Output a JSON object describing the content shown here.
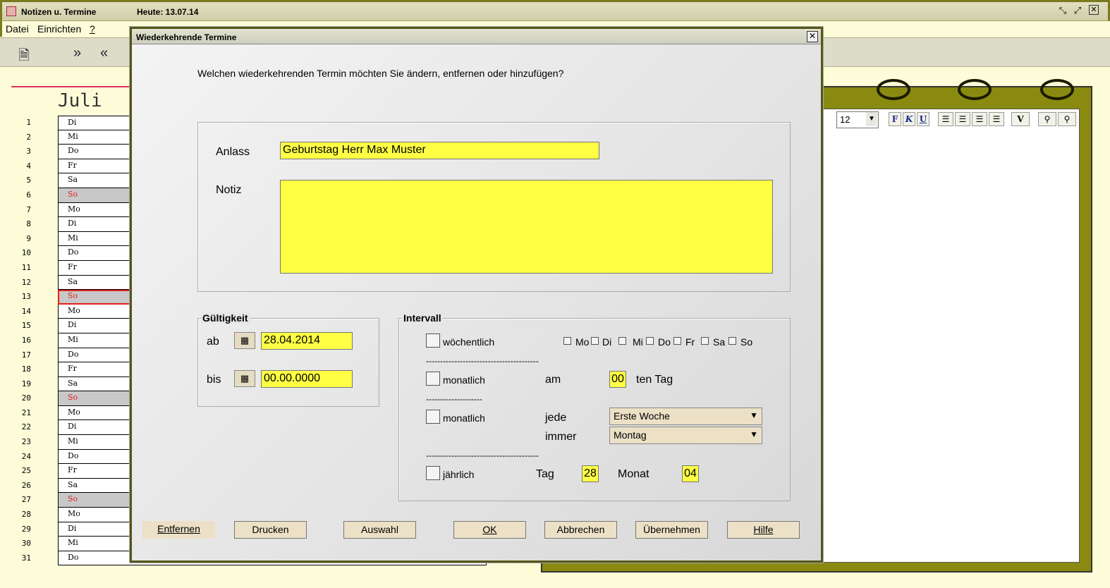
{
  "app": {
    "title": "Notizen u. Termine",
    "today": "Heute: 13.07.14"
  },
  "menu": [
    "Datei",
    "Einrichten",
    "?"
  ],
  "calendar": {
    "month": "Juli",
    "days": [
      {
        "n": "1",
        "d": "Di"
      },
      {
        "n": "2",
        "d": "Mi"
      },
      {
        "n": "3",
        "d": "Do"
      },
      {
        "n": "4",
        "d": "Fr"
      },
      {
        "n": "5",
        "d": "Sa"
      },
      {
        "n": "6",
        "d": "So"
      },
      {
        "n": "7",
        "d": "Mo"
      },
      {
        "n": "8",
        "d": "Di"
      },
      {
        "n": "9",
        "d": "Mi"
      },
      {
        "n": "10",
        "d": "Do"
      },
      {
        "n": "11",
        "d": "Fr"
      },
      {
        "n": "12",
        "d": "Sa"
      },
      {
        "n": "13",
        "d": "So"
      },
      {
        "n": "14",
        "d": "Mo"
      },
      {
        "n": "15",
        "d": "Di"
      },
      {
        "n": "16",
        "d": "Mi"
      },
      {
        "n": "17",
        "d": "Do"
      },
      {
        "n": "18",
        "d": "Fr"
      },
      {
        "n": "19",
        "d": "Sa"
      },
      {
        "n": "20",
        "d": "So"
      },
      {
        "n": "21",
        "d": "Mo"
      },
      {
        "n": "22",
        "d": "Di"
      },
      {
        "n": "23",
        "d": "Mi"
      },
      {
        "n": "24",
        "d": "Do"
      },
      {
        "n": "25",
        "d": "Fr"
      },
      {
        "n": "26",
        "d": "Sa"
      },
      {
        "n": "27",
        "d": "So"
      },
      {
        "n": "28",
        "d": "Mo"
      },
      {
        "n": "29",
        "d": "Di"
      },
      {
        "n": "30",
        "d": "Mi"
      },
      {
        "n": "31",
        "d": "Do"
      }
    ],
    "selected_day": "13"
  },
  "editor": {
    "font_size": "12",
    "bold": "F",
    "italic": "K",
    "underline": "U",
    "v_button": "V"
  },
  "dialog": {
    "title": "Wiederkehrende Termine",
    "question": "Welchen wiederkehrenden Termin möchten Sie ändern, entfernen oder hinzufügen?",
    "anlass_label": "Anlass",
    "anlass_value": "Geburtstag Herr Max Muster",
    "notiz_label": "Notiz",
    "notiz_value": "",
    "gueltigkeit": {
      "title": "Gültigkeit",
      "ab_label": "ab",
      "ab_value": "28.04.2014",
      "bis_label": "bis",
      "bis_value": "00.00.0000"
    },
    "intervall": {
      "title": "Intervall",
      "weekly_label": "wöchentlich",
      "weekdays": [
        "Mo",
        "Di",
        "Mi",
        "Do",
        "Fr",
        "Sa",
        "So"
      ],
      "monthly1_label": "monatlich",
      "am_label": "am",
      "am_value": "00",
      "ten_tag": "ten Tag",
      "monthly2_label": "monatlich",
      "jede_label": "jede",
      "jede_value": "Erste Woche",
      "immer_label": "immer",
      "immer_value": "Montag",
      "yearly_label": "jährlich",
      "tag_label": "Tag",
      "tag_value": "28",
      "monat_label": "Monat",
      "monat_value": "04",
      "sep1": "----------------------------------------",
      "sep2": "--------------------",
      "sep3": "----------------------------------------"
    },
    "buttons": {
      "entfernen": "Entfernen",
      "drucken": "Drucken",
      "auswahl": "Auswahl",
      "ok": "OK",
      "abbrechen": "Abbrechen",
      "uebernehmen": "Übernehmen",
      "hilfe": "Hilfe"
    }
  },
  "colors": {
    "field": "#ffff44",
    "notebook": "#8a8a10",
    "sunday_text": "#e02020",
    "frame": "#7a7a20"
  }
}
